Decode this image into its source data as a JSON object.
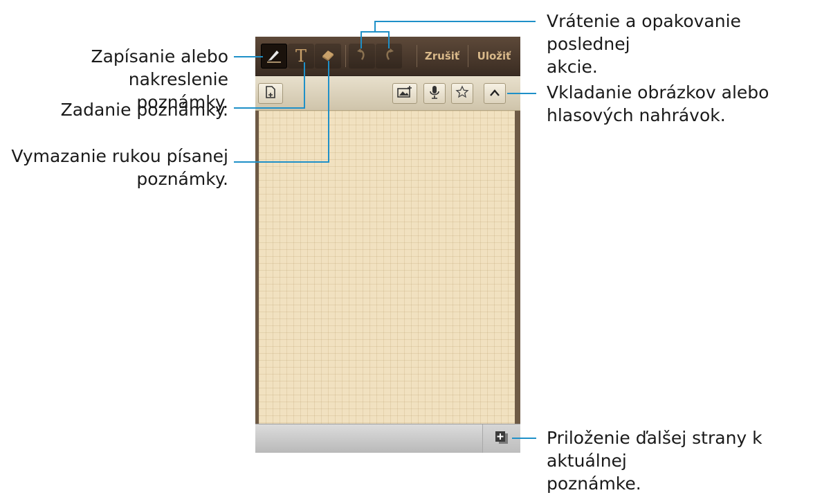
{
  "toolbar": {
    "pen_icon": "pen-icon",
    "text_icon_glyph": "T",
    "eraser_icon": "eraser-icon",
    "undo_icon": "undo-icon",
    "redo_icon": "redo-icon",
    "cancel_label": "Zrušiť",
    "save_label": "Uložiť"
  },
  "subbar": {
    "page_settings_icon": "page-settings-icon",
    "insert_image_icon": "insert-image-icon",
    "voice_record_icon": "microphone-icon",
    "favorite_icon": "star-icon",
    "collapse_icon": "chevron-up-icon"
  },
  "bottombar": {
    "add_page_icon": "add-page-icon"
  },
  "callouts": {
    "pen": [
      "Zapísanie alebo nakreslenie",
      "poznámky."
    ],
    "text": [
      "Zadanie poznámky."
    ],
    "eraser": [
      "Vymazanie rukou písanej",
      "poznámky."
    ],
    "undo_redo": [
      "Vrátenie a opakovanie poslednej",
      "akcie."
    ],
    "insert": [
      "Vkladanie obrázkov alebo",
      "hlasových nahrávok."
    ],
    "add_page": [
      "Priloženie ďalšej strany k aktuálnej",
      "poznámke."
    ]
  },
  "colors": {
    "leader": "#1e90c8",
    "toolbar": "#4a3a2c",
    "paper": "#f1e1c0",
    "accent": "#c9a16a"
  }
}
